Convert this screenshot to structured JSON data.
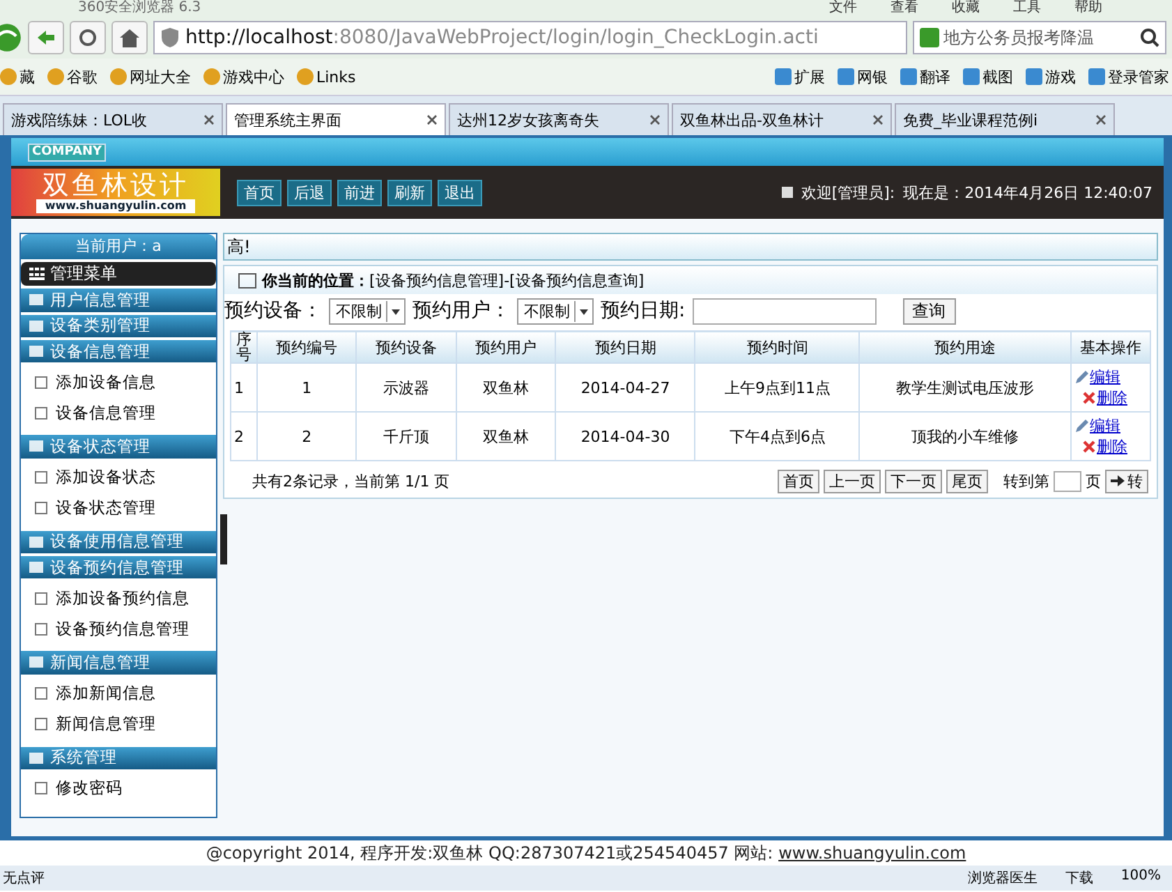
{
  "browser": {
    "title": "360安全浏览器 6.3",
    "menu": [
      "文件",
      "查看",
      "收藏",
      "工具",
      "帮助"
    ],
    "address": {
      "host": "http://localhost",
      "path": ":8080/JavaWebProject/login/login_CheckLogin.acti"
    },
    "search": {
      "value": "地方公务员报考降温"
    },
    "bookmarks_left": [
      "藏",
      "谷歌",
      "网址大全",
      "游戏中心",
      "Links"
    ],
    "bookmarks_right": [
      "扩展",
      "网银",
      "翻译",
      "截图",
      "游戏",
      "登录管家"
    ],
    "tabs": [
      {
        "title": "游戏陪练妹：LOL收",
        "selected": false
      },
      {
        "title": "管理系统主界面",
        "selected": true
      },
      {
        "title": "达州12岁女孩离奇失",
        "selected": false
      },
      {
        "title": "双鱼林出品-双鱼林计",
        "selected": false
      },
      {
        "title": "免费_毕业课程范例i",
        "selected": false
      }
    ],
    "status_bar": {
      "left": "无点评",
      "items": [
        "浏览器医生",
        "下载"
      ],
      "zoom": "100%"
    }
  },
  "header": {
    "company": "COMPANY",
    "logo": "双鱼林设计",
    "logo_url": "www.shuangyulin.com",
    "nav": [
      "首页",
      "后退",
      "前进",
      "刷新",
      "退出"
    ],
    "welcome": "欢迎[管理员]:",
    "now": "现在是：2014年4月26日 12:40:07"
  },
  "sidebar": {
    "user": "当前用户：a",
    "menu_title": "管理菜单",
    "groups": [
      {
        "label": "用户信息管理"
      },
      {
        "label": "设备类别管理"
      },
      {
        "label": "设备信息管理",
        "children": [
          "添加设备信息",
          "设备信息管理"
        ]
      },
      {
        "label": "设备状态管理",
        "children": [
          "添加设备状态",
          "设备状态管理"
        ]
      },
      {
        "label": "设备使用信息管理"
      },
      {
        "label": "设备预约信息管理",
        "children": [
          "添加设备预约信息",
          "设备预约信息管理"
        ]
      },
      {
        "label": "新闻信息管理",
        "children": [
          "添加新闻信息",
          "新闻信息管理"
        ]
      },
      {
        "label": "系统管理",
        "children": [
          "修改密码"
        ]
      }
    ]
  },
  "content": {
    "marquee": "高!",
    "breadcrumb": "**你当前的位置：**[设备预约信息管理]-[设备预约信息查询]",
    "filters": [
      {
        "label": "预约设备：",
        "kind": "select",
        "value": "不限制"
      },
      {
        "label": "预约用户：",
        "kind": "select",
        "value": "不限制"
      },
      {
        "label": "预约日期:",
        "kind": "input"
      }
    ],
    "query_button": "查询",
    "table": {
      "columns": [
        "序号",
        "预约编号",
        "预约设备",
        "预约用户",
        "预约日期",
        "预约时间",
        "预约用途",
        "基本操作"
      ],
      "rows": [
        {
          "cells": [
            "1",
            "1",
            "示波器",
            "双鱼林",
            "2014-04-27",
            "上午9点到11点",
            "教学生测试电压波形"
          ],
          "actions": [
            "编辑",
            "删除"
          ]
        },
        {
          "cells": [
            "2",
            "2",
            "千斤顶",
            "双鱼林",
            "2014-04-30",
            "下午4点到6点",
            "顶我的小车维修"
          ],
          "actions": [
            "编辑",
            "删除"
          ]
        }
      ]
    },
    "summary": "共有2条记录，当前第 1/1 页",
    "pager": [
      "首页",
      "上一页",
      "下一页",
      "尾页"
    ],
    "goto_label": "转到第",
    "goto_unit": "页",
    "goto_button": "转"
  },
  "footer": {
    "copyright": "@copyright 2014, 程序开发:双鱼林  QQ:287307421或254540457  网站:",
    "site": "www.shuangyulin.com"
  }
}
